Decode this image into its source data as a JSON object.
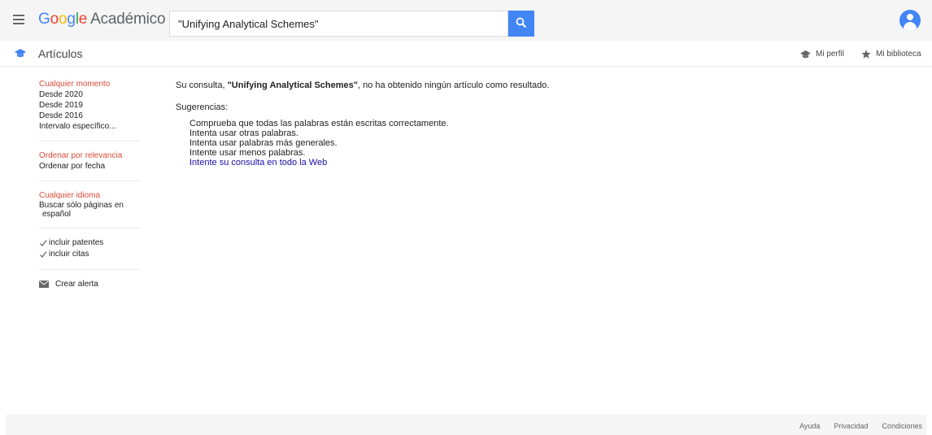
{
  "header": {
    "logo": {
      "letters": [
        "G",
        "o",
        "o",
        "g",
        "l",
        "e"
      ],
      "product": "Académico"
    },
    "search": {
      "value": "\"Unifying Analytical Schemes\""
    }
  },
  "subheader": {
    "title": "Artículos",
    "profile_label": "Mi perfil",
    "library_label": "Mi biblioteca"
  },
  "sidebar": {
    "time": {
      "active": "Cualquier momento",
      "options": [
        "Desde 2020",
        "Desde 2019",
        "Desde 2016",
        "Intervalo específico..."
      ]
    },
    "sort": {
      "active": "Ordenar por relevancia",
      "option": "Ordenar por fecha"
    },
    "language": {
      "active": "Cualquier idioma",
      "option_line1": "Buscar sólo páginas en",
      "option_line2": "español"
    },
    "include_patents": "incluir patentes",
    "include_citations": "incluir citas",
    "create_alert": "Crear alerta"
  },
  "results": {
    "message_prefix": "Su consulta, ",
    "query": "\"Unifying Analytical Schemes\"",
    "message_suffix": ", no ha obtenido ningún artículo como resultado.",
    "suggestions_heading": "Sugerencias:",
    "suggestions": [
      "Comprueba que todas las palabras están escritas correctamente.",
      "Intenta usar otras palabras.",
      "Intenta usar palabras más generales.",
      "Intente usar menos palabras."
    ],
    "web_link": "Intente su consulta en todo la Web"
  },
  "footer": {
    "links": [
      "Ayuda",
      "Privacidad",
      "Condiciones"
    ]
  },
  "colors": {
    "accent": "#4285f4",
    "active": "#dd4b39",
    "link": "#1a0dab"
  }
}
